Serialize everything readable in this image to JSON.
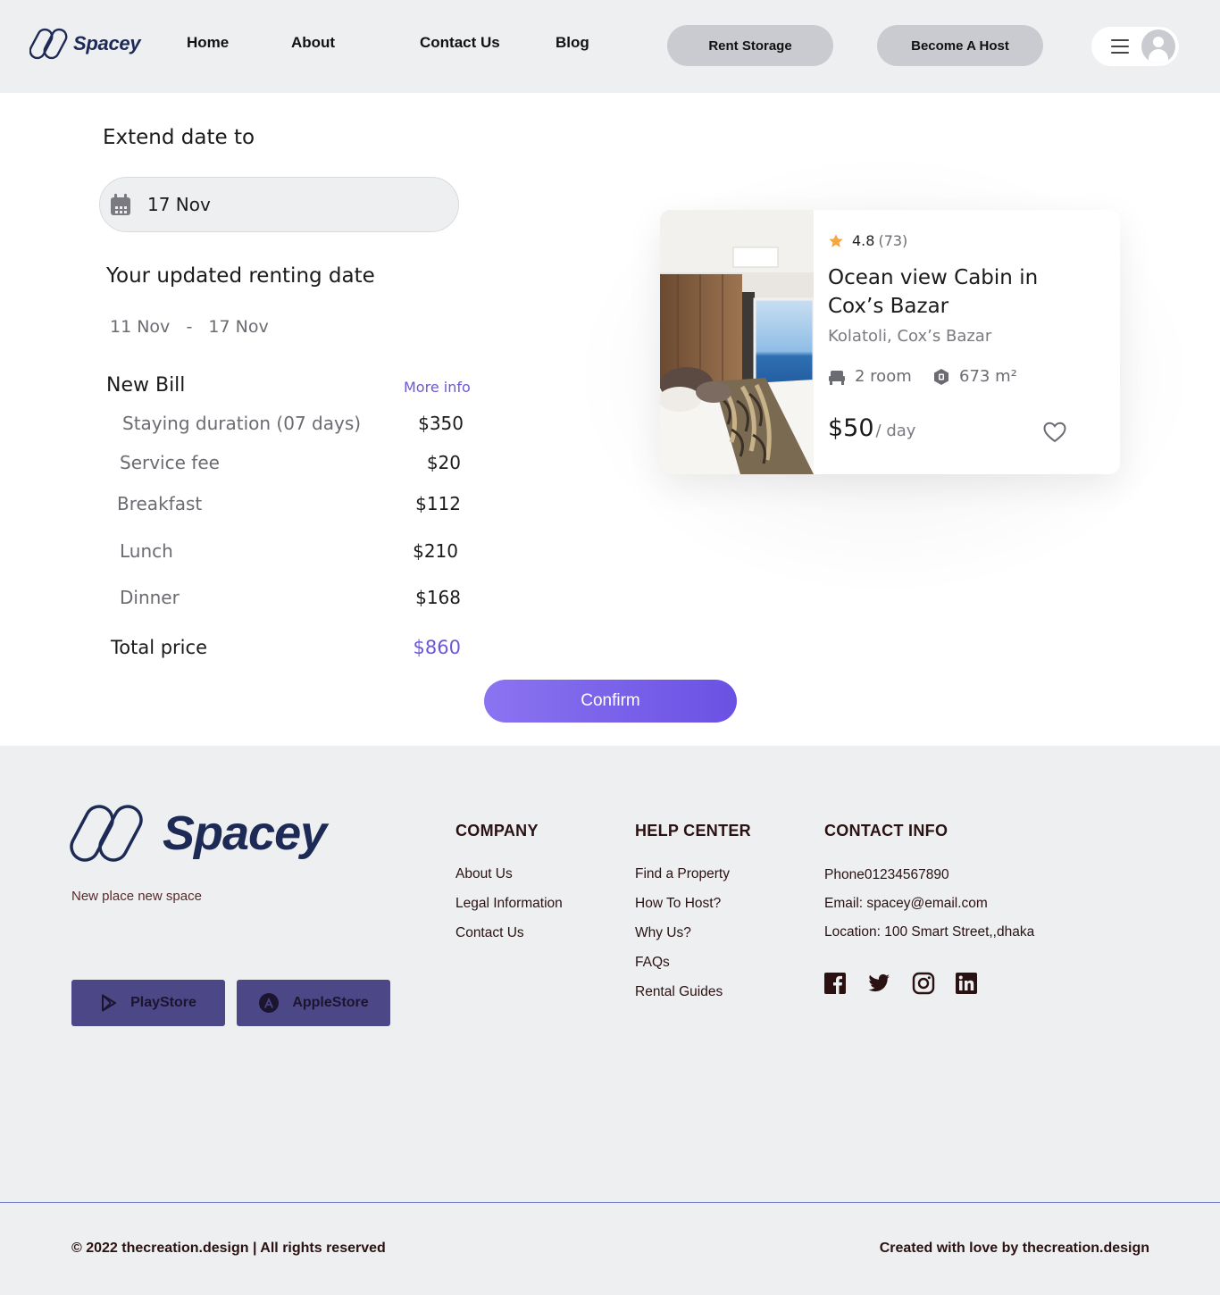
{
  "header": {
    "brand": "Spacey",
    "nav": [
      "Home",
      "About",
      "Contact Us",
      "Blog"
    ],
    "rent_storage": "Rent Storage",
    "become_host": "Become A Host"
  },
  "extend": {
    "title": "Extend date to",
    "date_value": "17 Nov"
  },
  "renting": {
    "title": "Your updated renting date",
    "start": "11 Nov",
    "separator": "-",
    "end": "17 Nov"
  },
  "bill": {
    "title": "New Bill",
    "more_info": "More info",
    "items": [
      {
        "label": "Staying duration (07 days)",
        "amount": "$350"
      },
      {
        "label": "Service fee",
        "amount": "$20"
      },
      {
        "label": "Breakfast",
        "amount": "$112"
      },
      {
        "label": "Lunch",
        "amount": "$210"
      },
      {
        "label": "Dinner",
        "amount": "$168"
      }
    ],
    "total_label": "Total price",
    "total_amount": "$860"
  },
  "confirm_label": "Confirm",
  "listing": {
    "rating": "4.8",
    "reviews": "(73)",
    "title": "Ocean view Cabin in Cox’s Bazar",
    "location": "Kolatoli, Cox’s Bazar",
    "rooms": "2 room",
    "area": "673 m²",
    "price": "$50",
    "per": "/ day"
  },
  "footer": {
    "brand": "Spacey",
    "tagline": "New place new  space",
    "playstore": "PlayStore",
    "applestore": "AppleStore",
    "company": {
      "title": "COMPANY",
      "links": [
        "About Us",
        "Legal Information",
        "Contact Us"
      ]
    },
    "help": {
      "title": "HELP CENTER",
      "links": [
        "Find a Property",
        "How To Host?",
        "Why Us?",
        "FAQs",
        "Rental Guides"
      ]
    },
    "contact": {
      "title": "CONTACT INFO",
      "phone": "Phone01234567890",
      "email": "Email: spacey@email.com",
      "location": "Location: 100 Smart Street,,dhaka"
    },
    "social_icons": [
      "facebook-icon",
      "twitter-icon",
      "instagram-icon",
      "linkedin-icon"
    ],
    "copyright": "© 2022 thecreation.design | All rights reserved",
    "credit_prefix": "Created with love by",
    "credit_brand": "thecreation.design"
  },
  "colors": {
    "accent": "#6e56d8",
    "brand_navy": "#1c2a55",
    "store_button": "#4c4786",
    "star": "#f5a742"
  }
}
